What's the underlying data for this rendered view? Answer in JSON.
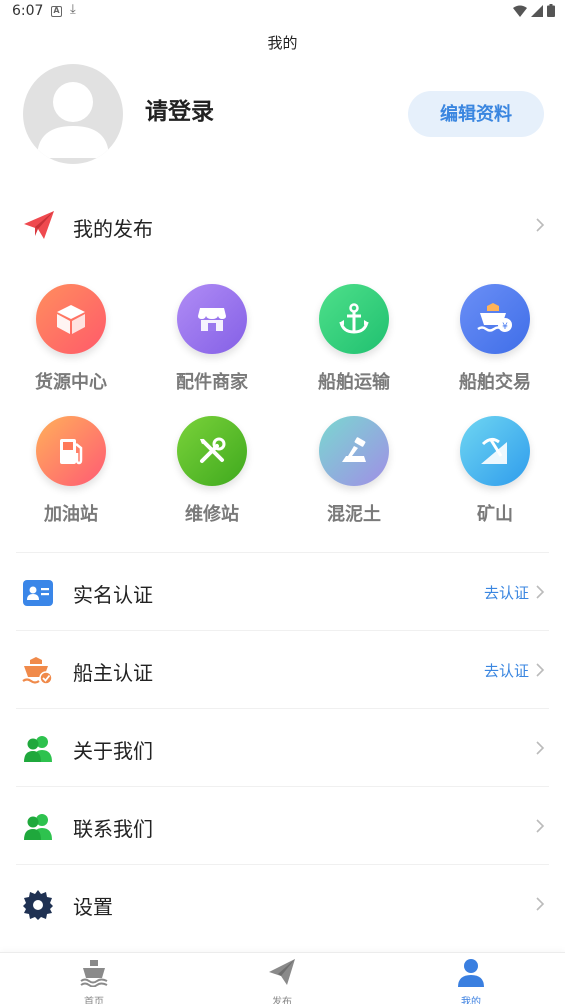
{
  "status": {
    "time": "6:07",
    "a_icon": "A"
  },
  "header": {
    "title": "我的"
  },
  "profile": {
    "login_text": "请登录",
    "edit_button": "编辑资料"
  },
  "publish": {
    "label": "我的发布"
  },
  "grid": [
    {
      "label": "货源中心",
      "icon": "box-icon",
      "color": "#ff6a5e"
    },
    {
      "label": "配件商家",
      "icon": "store-icon",
      "color": "#9b74ee"
    },
    {
      "label": "船舶运输",
      "icon": "anchor-icon",
      "color": "#2ccf7a"
    },
    {
      "label": "船舶交易",
      "icon": "ship-trade-icon",
      "color": "#4a7cf0"
    },
    {
      "label": "加油站",
      "icon": "fuel-icon",
      "color": "#ff7a5a"
    },
    {
      "label": "维修站",
      "icon": "tools-icon",
      "color": "#5bbd2a"
    },
    {
      "label": "混泥土",
      "icon": "trowel-icon",
      "color": "#8a9be0"
    },
    {
      "label": "矿山",
      "icon": "pickaxe-icon",
      "color": "#3aa8ef"
    }
  ],
  "list": [
    {
      "label": "实名认证",
      "action": "去认证",
      "icon": "id-card-icon"
    },
    {
      "label": "船主认证",
      "action": "去认证",
      "icon": "ship-owner-icon"
    },
    {
      "label": "关于我们",
      "action": "",
      "icon": "users-icon"
    },
    {
      "label": "联系我们",
      "action": "",
      "icon": "users-icon"
    },
    {
      "label": "设置",
      "action": "",
      "icon": "gear-icon"
    }
  ],
  "tabs": [
    {
      "label": "首页",
      "icon": "ship-home-icon"
    },
    {
      "label": "发布",
      "icon": "paper-plane-icon"
    },
    {
      "label": "我的",
      "icon": "person-icon",
      "active": true
    }
  ]
}
